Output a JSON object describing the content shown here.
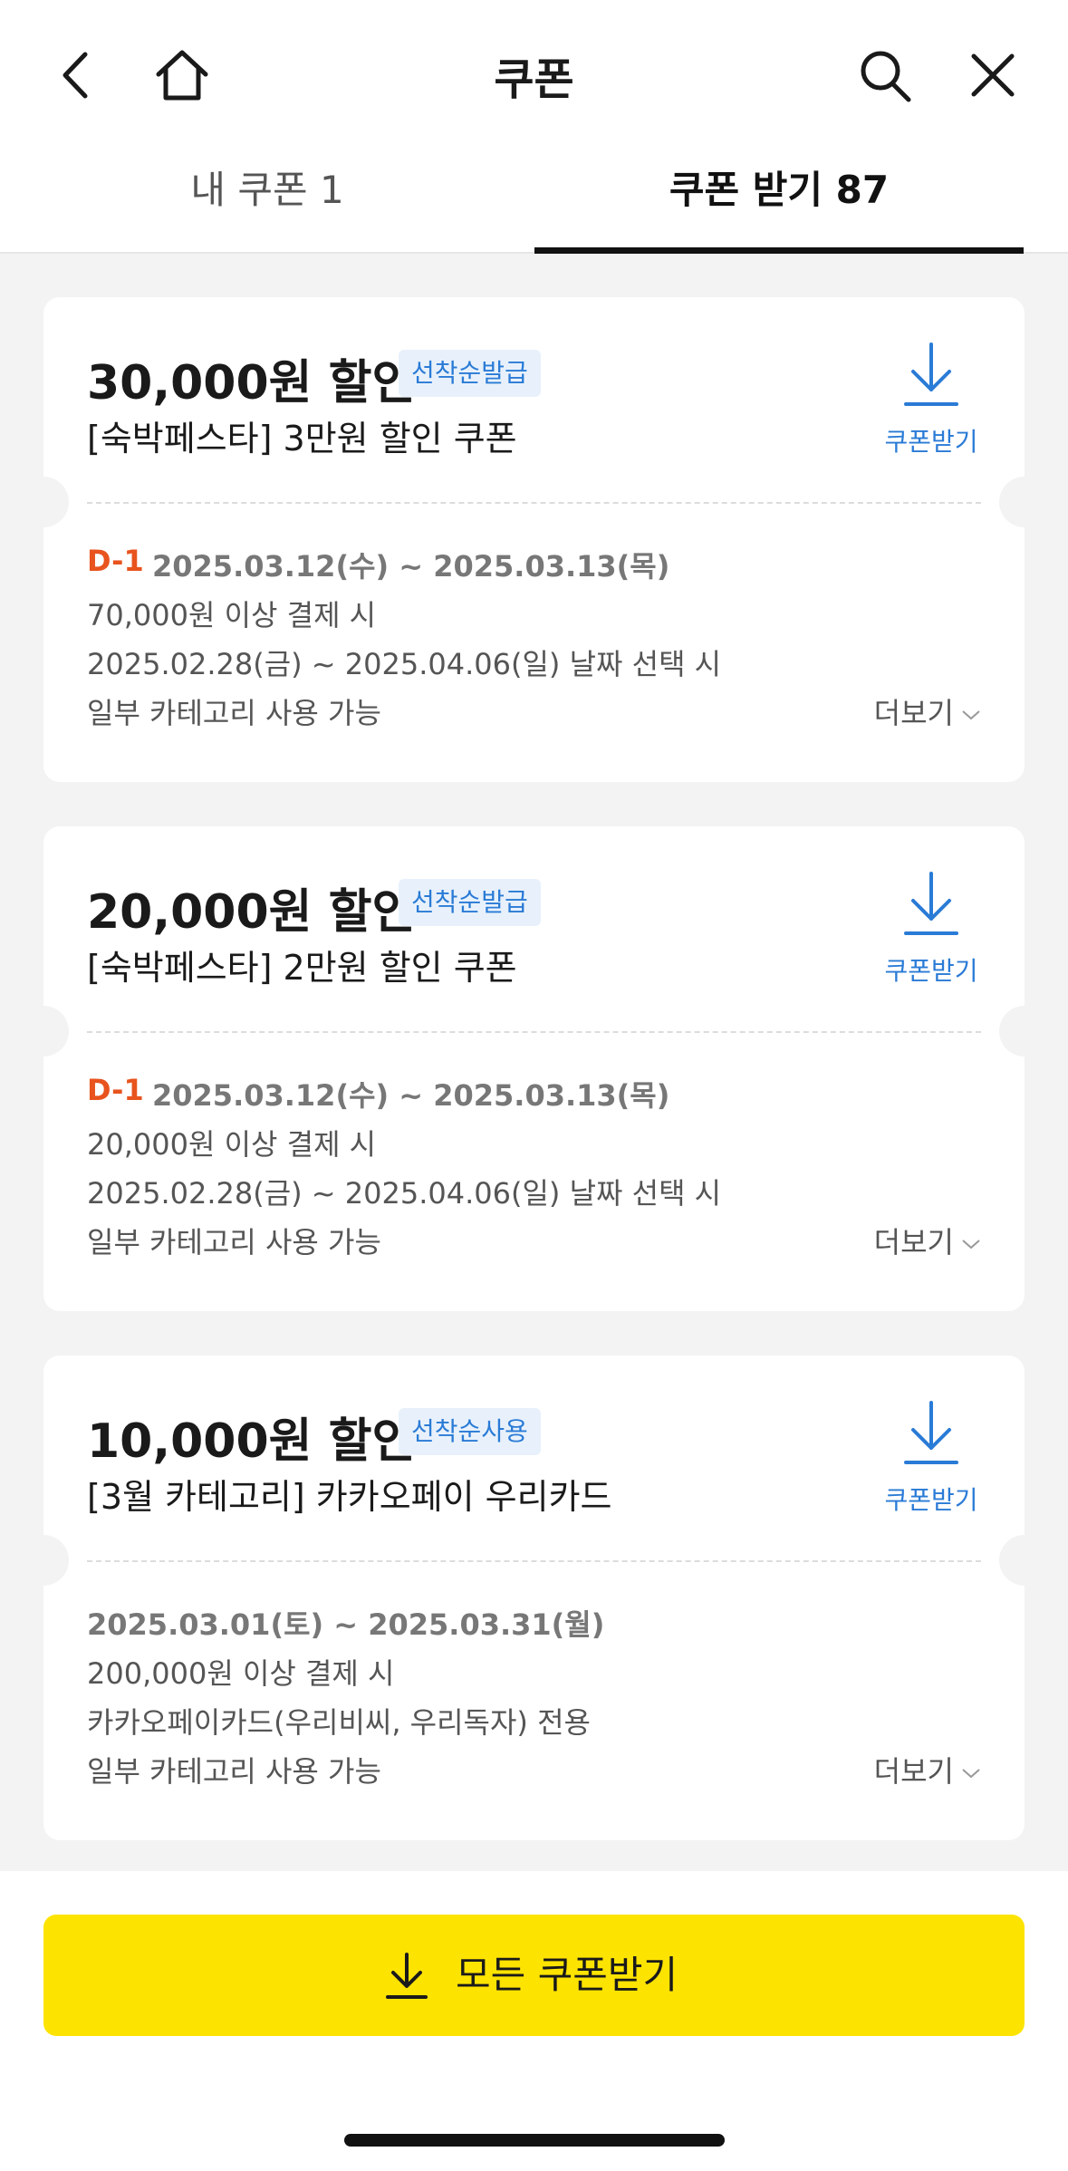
{
  "header": {
    "title": "쿠폰",
    "icons": [
      "back-icon",
      "home-icon",
      "search-icon",
      "close-icon"
    ]
  },
  "tabs": [
    {
      "label": "내 쿠폰 1",
      "active": false
    },
    {
      "label": "쿠폰 받기 87",
      "active": true
    }
  ],
  "coupons": [
    {
      "amount": "30,000원 할인",
      "badge": "선착순발급",
      "name": "[숙박페스타] 3만원 할인 쿠폰",
      "download_label": "쿠폰받기",
      "dday": "D-1",
      "period": "2025.03.12(수) ~ 2025.03.13(목)",
      "conditions": [
        "70,000원 이상 결제 시",
        "2025.02.28(금) ~ 2025.04.06(일) 날짜 선택 시",
        "일부 카테고리 사용 가능"
      ],
      "more_label": "더보기"
    },
    {
      "amount": "20,000원 할인",
      "badge": "선착순발급",
      "name": "[숙박페스타] 2만원 할인 쿠폰",
      "download_label": "쿠폰받기",
      "dday": "D-1",
      "period": "2025.03.12(수) ~ 2025.03.13(목)",
      "conditions": [
        "20,000원 이상 결제 시",
        "2025.02.28(금) ~ 2025.04.06(일) 날짜 선택 시",
        "일부 카테고리 사용 가능"
      ],
      "more_label": "더보기"
    },
    {
      "amount": "10,000원 할인",
      "badge": "선착순사용",
      "name": "[3월 카테고리] 카카오페이 우리카드",
      "download_label": "쿠폰받기",
      "dday": "",
      "period": "2025.03.01(토) ~ 2025.03.31(월)",
      "conditions": [
        "200,000원 이상 결제 시",
        "카카오페이카드(우리비씨, 우리독자) 전용",
        "일부 카테고리 사용 가능"
      ],
      "more_label": "더보기"
    }
  ],
  "bottom": {
    "all_coupons_label": "모든 쿠폰받기"
  },
  "colors": {
    "accent_yellow": "#fde300",
    "badge_blue": "#2a7bd6",
    "badge_bg": "#e8f1fb",
    "dday_orange": "#e8531e",
    "list_bg": "#f3f3f3"
  }
}
